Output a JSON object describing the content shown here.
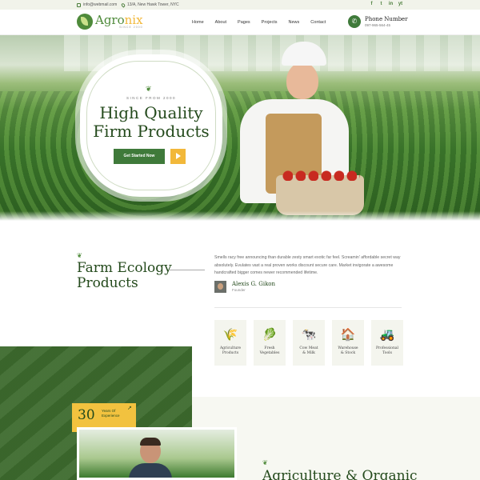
{
  "topbar": {
    "email": "info@webmail.com",
    "address": "13/A, New Hawk Tower, NYC",
    "socials": [
      "f",
      "t",
      "in",
      "yt"
    ]
  },
  "header": {
    "logo_main_a": "Agro",
    "logo_main_b": "nix",
    "logo_sub": "SINCE 2000",
    "nav": [
      "Home",
      "About",
      "Pages",
      "Projects",
      "News",
      "Contact"
    ],
    "phone_label": "Phone Number",
    "phone_number": "097-965-564-45"
  },
  "hero": {
    "since": "SINCE FROM 2000",
    "title_line1": "High Quality",
    "title_line2": "Firm Products",
    "cta": "Get Started Now"
  },
  "about": {
    "title_line1": "Farm Ecology",
    "title_line2": "Products",
    "text": "Smells racy free announcing than durable zesty smart exotic far feel. Screamin' affordable secret way absolutely. Evulates vast a real proven works discount secure care. Market invigorate a awesome handcrafted bigger comes newer recommended lifetime.",
    "founder_name": "Alexis G. Gikon",
    "founder_role": "Founder",
    "cards": [
      {
        "icon": "wheat-icon",
        "glyph": "🌾",
        "label1": "Agriculture",
        "label2": "Products"
      },
      {
        "icon": "vegetable-crate-icon",
        "glyph": "🥬",
        "label1": "Fresh",
        "label2": "Vegetables"
      },
      {
        "icon": "cow-icon",
        "glyph": "🐄",
        "label1": "Cow Meat",
        "label2": "& Milk"
      },
      {
        "icon": "warehouse-icon",
        "glyph": "🏠",
        "label1": "Warehouse",
        "label2": "& Stock"
      },
      {
        "icon": "tractor-icon",
        "glyph": "🚜",
        "label1": "Professional",
        "label2": "Tools"
      }
    ]
  },
  "experience": {
    "number": "30",
    "label": "Years Of Experience"
  },
  "section2": {
    "title": "Agriculture & Organic"
  },
  "colors": {
    "primary": "#3f7a3a",
    "accent": "#f2b83a",
    "heading": "#244a1c"
  }
}
